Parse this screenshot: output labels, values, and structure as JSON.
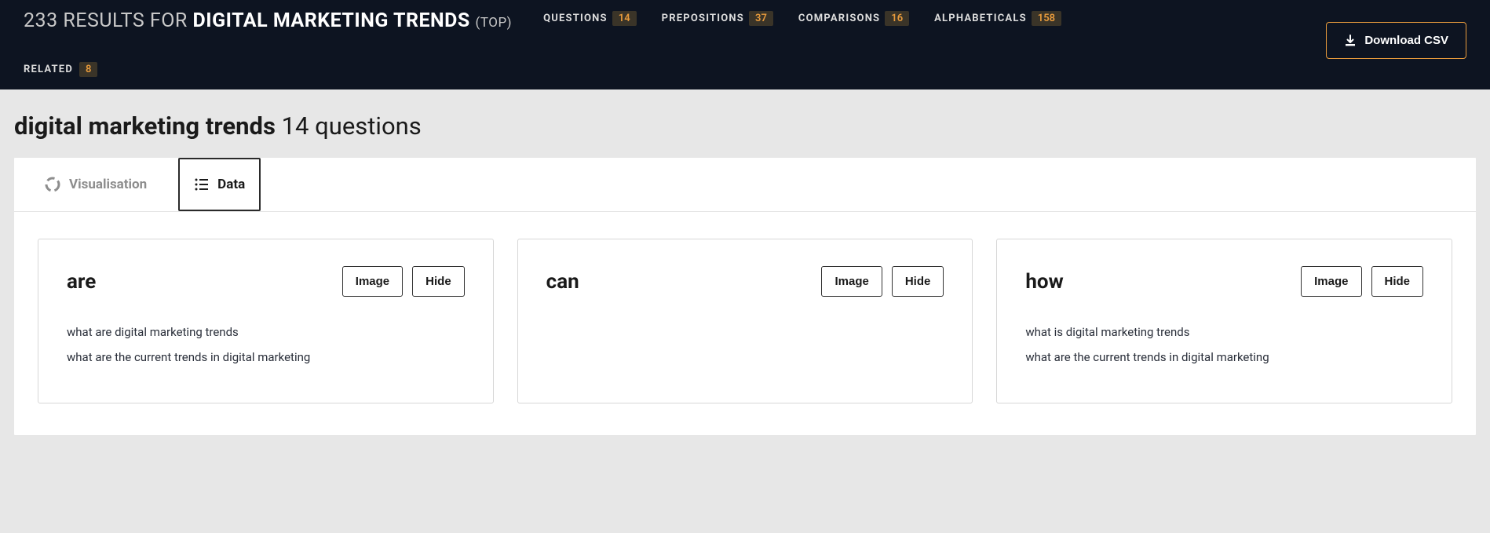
{
  "header": {
    "results_count": "233",
    "results_prefix": "RESULTS FOR",
    "query": "DIGITAL MARKETING TRENDS",
    "top_label": "(TOP)",
    "nav": [
      {
        "label": "QUESTIONS",
        "count": "14"
      },
      {
        "label": "PREPOSITIONS",
        "count": "37"
      },
      {
        "label": "COMPARISONS",
        "count": "16"
      },
      {
        "label": "ALPHABETICALS",
        "count": "158"
      }
    ],
    "related": {
      "label": "RELATED",
      "count": "8"
    },
    "download": "Download CSV"
  },
  "section": {
    "query": "digital marketing trends",
    "subtitle": "14 questions"
  },
  "view_tabs": {
    "visualisation": "Visualisation",
    "data": "Data"
  },
  "card_buttons": {
    "image": "Image",
    "hide": "Hide"
  },
  "cards": [
    {
      "title": "are",
      "items": [
        "what are digital marketing trends",
        "what are the current trends in digital marketing"
      ]
    },
    {
      "title": "can",
      "items": []
    },
    {
      "title": "how",
      "items": [
        "what is digital marketing trends",
        "what are the current trends in digital marketing"
      ]
    }
  ]
}
